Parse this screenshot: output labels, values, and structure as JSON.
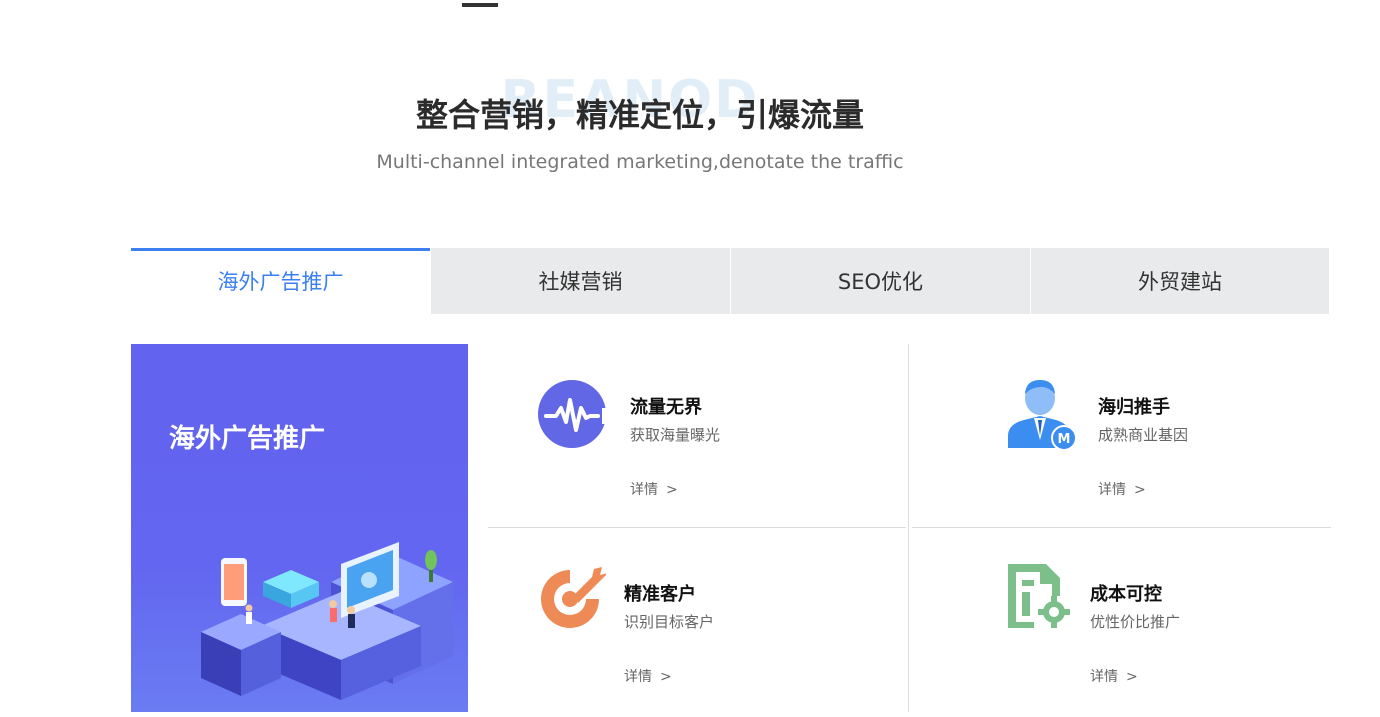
{
  "watermark": "REANOD",
  "header": {
    "title": "整合营销，精准定位，引爆流量",
    "subtitle": "Multi-channel integrated marketing,denotate the traffic"
  },
  "tabs": [
    {
      "label": "海外广告推广",
      "active": true
    },
    {
      "label": "社媒营销",
      "active": false
    },
    {
      "label": "SEO优化",
      "active": false
    },
    {
      "label": "外贸建站",
      "active": false
    }
  ],
  "promo": {
    "title": "海外广告推广",
    "background_color": "#6263ef"
  },
  "features": [
    {
      "title": "流量无界",
      "desc": "获取海量曝光",
      "link": "详情",
      "icon": "pulse-wave-icon",
      "color": "#6267e6"
    },
    {
      "title": "海归推手",
      "desc": "成熟商业基因",
      "link": "详情",
      "icon": "manager-avatar-icon",
      "color": "#3b8df0"
    },
    {
      "title": "精准客户",
      "desc": "识别目标客户",
      "link": "详情",
      "icon": "target-arrow-icon",
      "color": "#ee8a55"
    },
    {
      "title": "成本可控",
      "desc": "优性价比推广",
      "link": "详情",
      "icon": "document-gear-icon",
      "color": "#7cbf8a"
    }
  ],
  "link_chevron": ">",
  "colors": {
    "accent": "#3b7ff0",
    "tab_inactive_bg": "#e9eaeb"
  }
}
